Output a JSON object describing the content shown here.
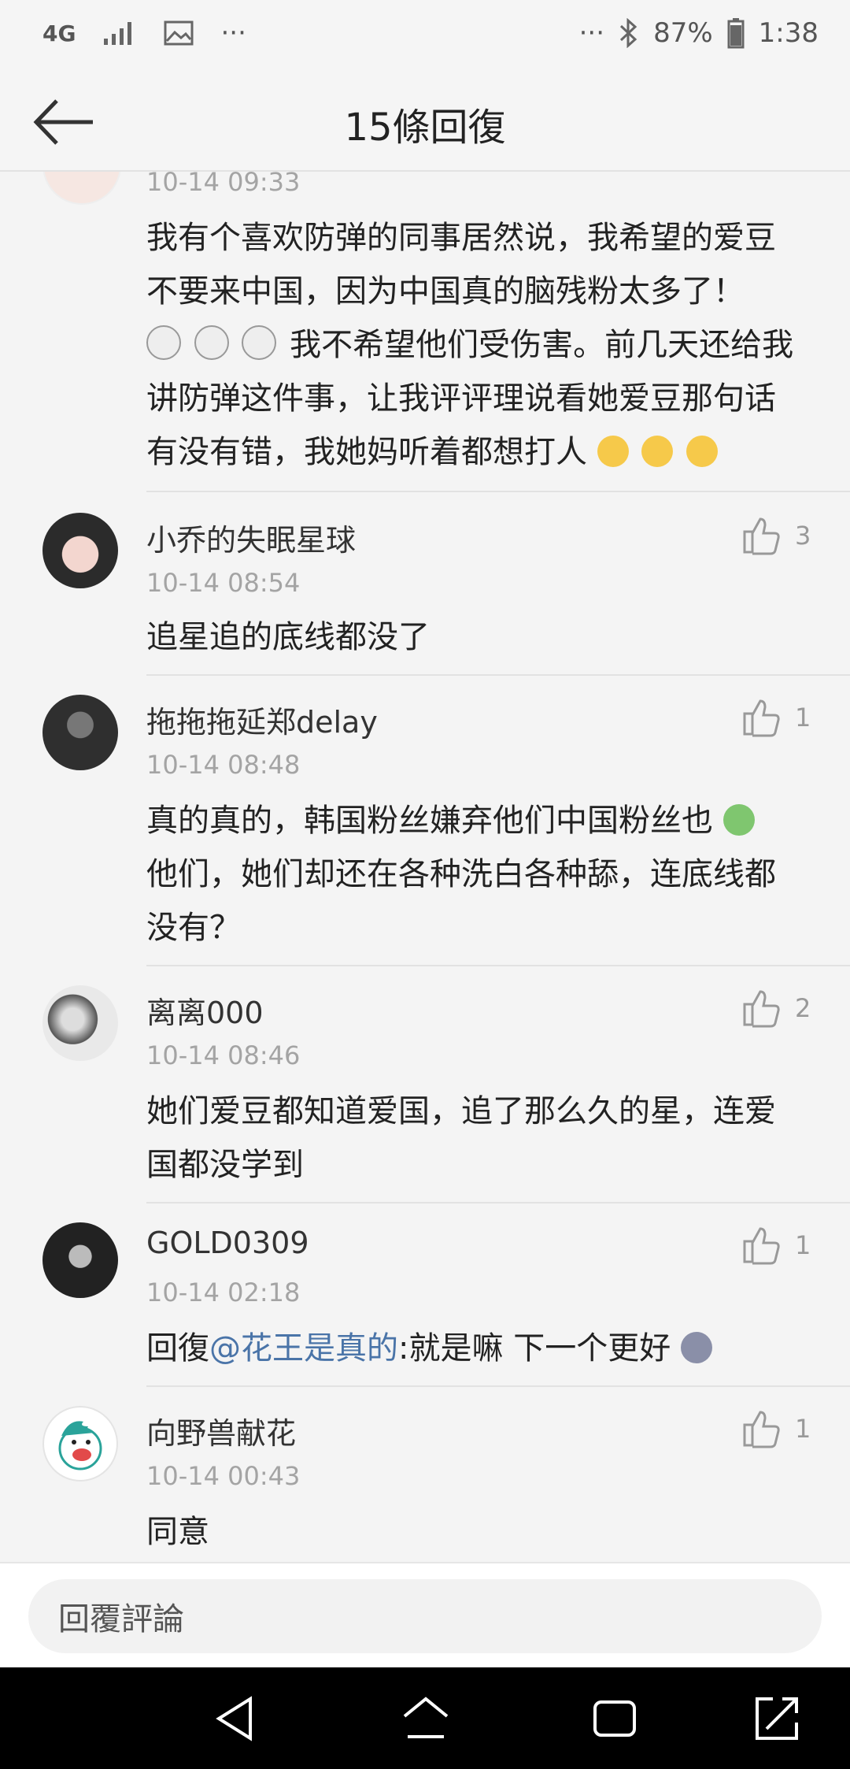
{
  "status_bar": {
    "network": "4G",
    "more_left": "···",
    "more_right": "···",
    "battery": "87%",
    "time": "1:38"
  },
  "header": {
    "title": "15條回復"
  },
  "replies": [
    {
      "time": "10-14 09:33",
      "text_lines": [
        "我有个喜欢防弹的同事居然说，我希望的爱豆",
        "不要来中国，因为中国真的脑残粉太多了！",
        "我不希望他们受伤害。前几天还给我",
        "讲防弹这件事，让我评评理说看她爱豆那句话",
        "有没有错，我她妈听着都想打人"
      ]
    },
    {
      "name": "小乔的失眠星球",
      "likes": "3",
      "time": "10-14 08:54",
      "text": "追星追的底线都没了"
    },
    {
      "name": "拖拖拖延郑delay",
      "likes": "1",
      "time": "10-14 08:48",
      "text_lines": [
        "真的真的，韩国粉丝嫌弃他们中国粉丝也",
        "他们，她们却还在各种洗白各种舔，连底线都",
        "没有？"
      ]
    },
    {
      "name": "离离000",
      "likes": "2",
      "time": "10-14 08:46",
      "text_lines": [
        "她们爱豆都知道爱国，追了那么久的星，连爱",
        "国都没学到"
      ]
    },
    {
      "name": "GOLD0309",
      "likes": "1",
      "time": "10-14 02:18",
      "reply_prefix": "回復",
      "mention": "@花王是真的",
      "text": ":就是嘛 下一个更好"
    },
    {
      "name": "向野兽献花",
      "likes": "1",
      "time": "10-14 00:43",
      "text": "同意"
    }
  ],
  "composer": {
    "placeholder": "回覆評論"
  },
  "colors": {
    "mention": "#4a74a8",
    "timestamp": "#a4a4a4",
    "background": "#f4f4f4"
  }
}
